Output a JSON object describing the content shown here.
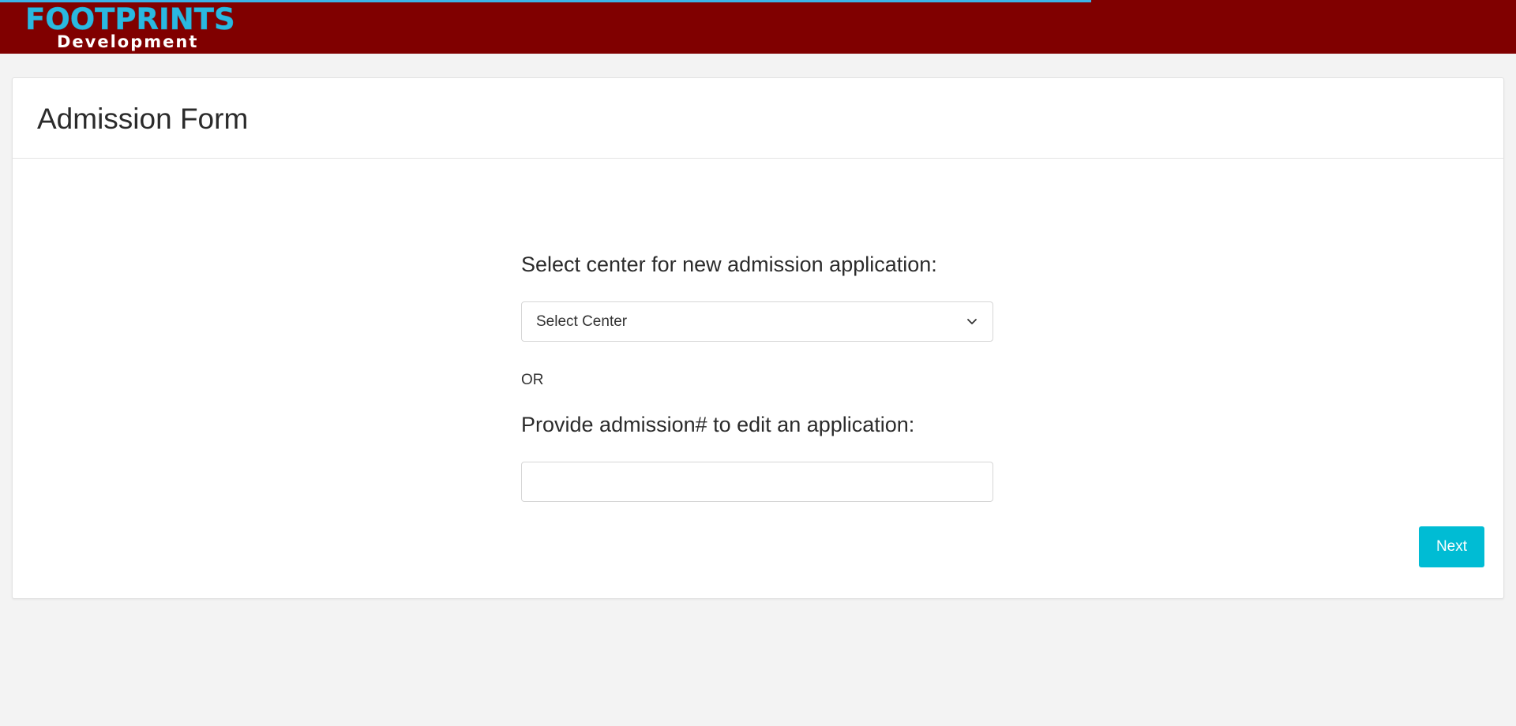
{
  "header": {
    "logo_main": "FOOTPRINTS",
    "logo_sub": "Development",
    "bar_color": "#800000",
    "loading_progress": 0.72
  },
  "card": {
    "title": "Admission Form"
  },
  "form": {
    "center_label": "Select center for new admission application:",
    "center_select_value": "Select Center",
    "or_label": "OR",
    "admission_label": "Provide admission# to edit an application:",
    "admission_input_value": ""
  },
  "actions": {
    "next_label": "Next",
    "accent_color": "#00bcd4"
  },
  "icons": {
    "select_chevron": "chevron-down-icon"
  }
}
